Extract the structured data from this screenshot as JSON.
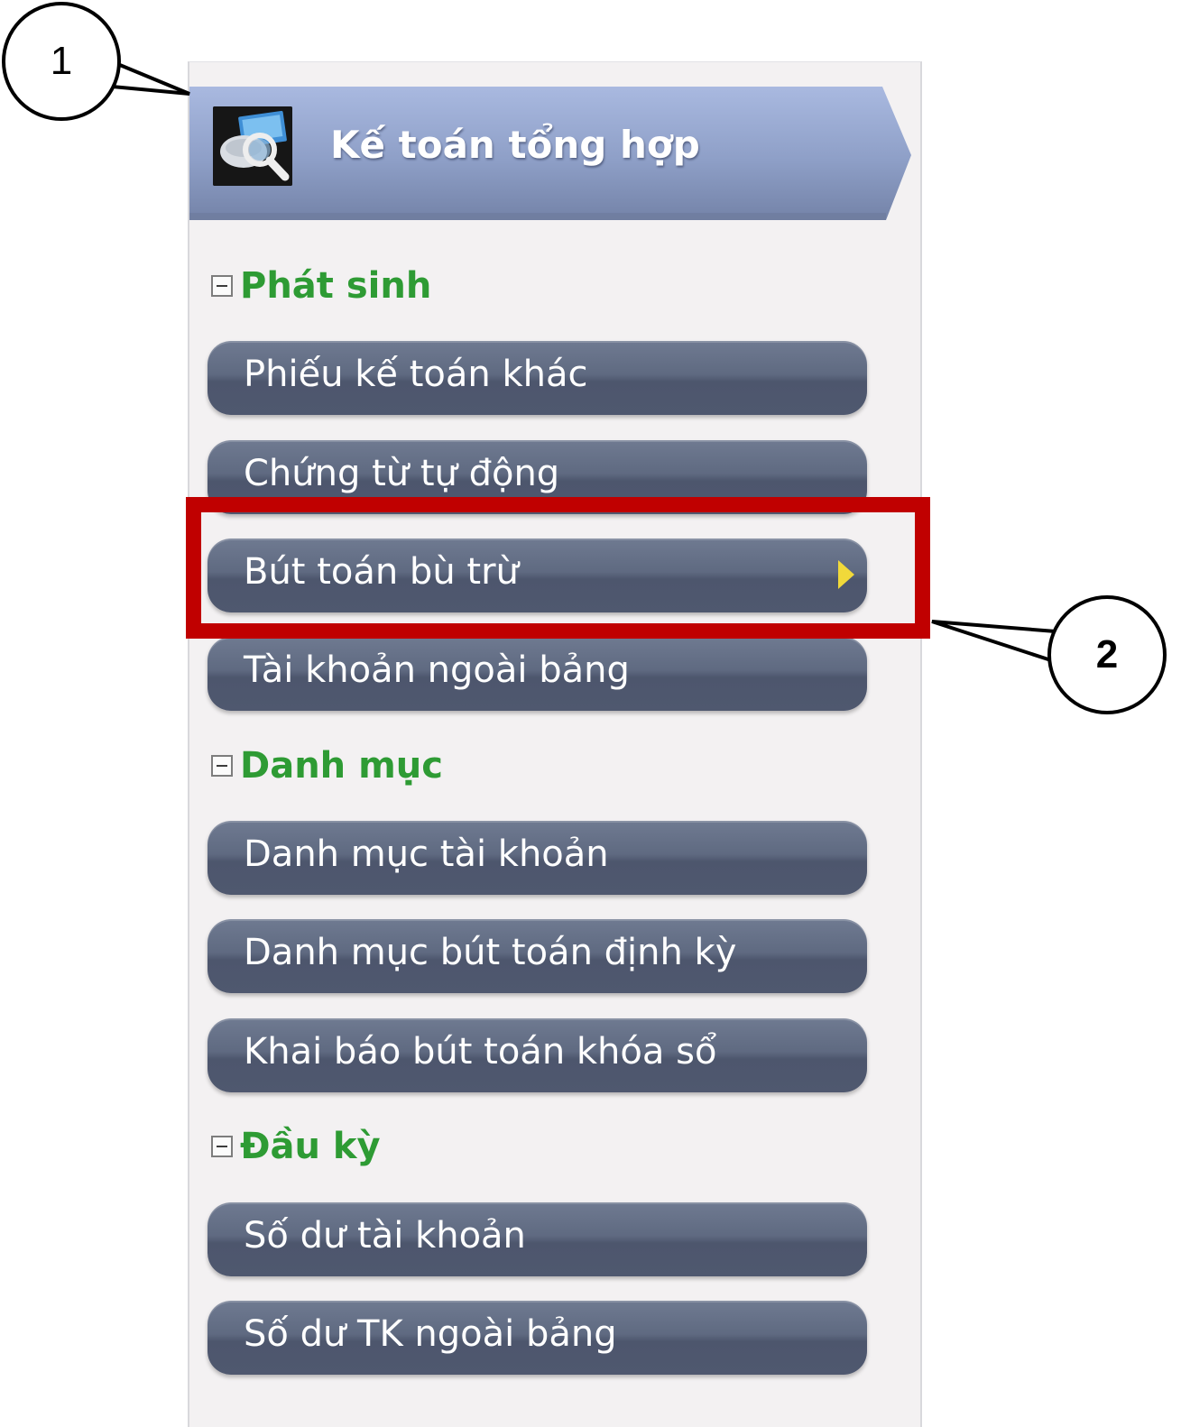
{
  "header": {
    "title": "Kế toán tổng hợp",
    "icon": "accounting-search-icon"
  },
  "sections": [
    {
      "label": "Phát sinh",
      "expanded": true,
      "items": [
        {
          "label": "Phiếu kế toán khác"
        },
        {
          "label": "Chứng từ tự động"
        },
        {
          "label": "Bút toán bù trừ",
          "active": true
        },
        {
          "label": "Tài khoản ngoài bảng"
        }
      ]
    },
    {
      "label": "Danh mục",
      "expanded": true,
      "items": [
        {
          "label": "Danh mục tài khoản"
        },
        {
          "label": "Danh mục bút toán định kỳ"
        },
        {
          "label": "Khai báo bút toán khóa sổ"
        }
      ]
    },
    {
      "label": "Đầu kỳ",
      "expanded": true,
      "items": [
        {
          "label": "Số dư tài khoản"
        },
        {
          "label": "Số dư TK ngoài bảng"
        }
      ]
    }
  ],
  "annotations": {
    "callout_1": "1",
    "callout_2": "2"
  },
  "colors": {
    "section_heading": "#2e9b34",
    "button": "#5f6a81",
    "highlight": "#c00000",
    "active_arrow": "#f1d93a"
  }
}
